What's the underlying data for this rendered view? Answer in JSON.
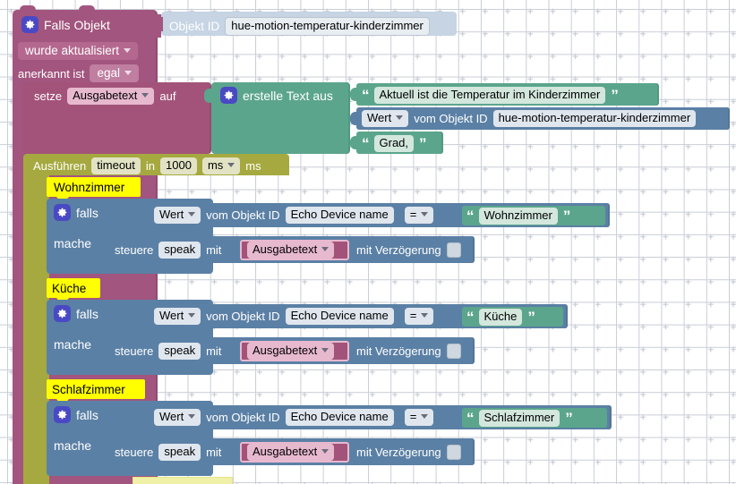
{
  "app": {
    "type": "blockly-workspace",
    "language": "de",
    "background": "#ffffff",
    "grid_color": "#c9cdd6"
  },
  "colors": {
    "trigger_purple": "#a2557e",
    "variable_pink": "#a35379",
    "timeout_olive": "#a5a93f",
    "text_green": "#5ba58c",
    "logic_blue": "#5b80a5",
    "objectid_lightblue": "#c6d4e4",
    "comment_yellow": "#ffff00",
    "gear_icon": "#4a49c4"
  },
  "trigger": {
    "gear_icon": "gear-icon",
    "title": "Falls Objekt",
    "objectid_label": "Objekt ID",
    "objectid_value": "hue-motion-temperatur-kinderzimmer",
    "condition_dropdown": "wurde aktualisiert",
    "ack_label": "anerkannt ist",
    "ack_dropdown": "egal"
  },
  "set_variable": {
    "set_label": "setze",
    "variable_dropdown": "Ausgabetext",
    "to_label": "auf"
  },
  "create_text": {
    "gear_icon": "gear-icon",
    "title": "erstelle Text aus",
    "open_quote": "“",
    "close_quote": "”",
    "parts": [
      {
        "kind": "text",
        "value": "Aktuell ist die Temperatur im Kinderzimmer"
      },
      {
        "kind": "getvalue",
        "attr_dropdown": "Wert",
        "from_label": "vom Objekt ID",
        "objectid": "hue-motion-temperatur-kinderzimmer"
      },
      {
        "kind": "text",
        "value": "Grad,"
      }
    ]
  },
  "timeout": {
    "run_label": "Ausführen",
    "name_field": "timeout",
    "in_label": "in",
    "delay_value": "1000",
    "unit_dropdown": "ms",
    "unit_suffix": "ms"
  },
  "branches": [
    {
      "comment": "Wohnzimmer",
      "gear_icon": "gear-icon",
      "if_label": "falls",
      "attr_dropdown": "Wert",
      "from_label": "vom Objekt ID",
      "objectid": "Echo Device name",
      "operator": "=",
      "compare_open_quote": "“",
      "compare_value": "Wohnzimmer",
      "compare_close_quote": "”",
      "do_label": "mache",
      "control_label": "steuere",
      "control_field": "speak",
      "with_label": "mit",
      "value_dropdown": "Ausgabetext",
      "delay_label": "mit Verzögerung",
      "delay_checked": false
    },
    {
      "comment": "Küche",
      "gear_icon": "gear-icon",
      "if_label": "falls",
      "attr_dropdown": "Wert",
      "from_label": "vom Objekt ID",
      "objectid": "Echo Device name",
      "operator": "=",
      "compare_open_quote": "“",
      "compare_value": "Küche",
      "compare_close_quote": "”",
      "do_label": "mache",
      "control_label": "steuere",
      "control_field": "speak",
      "with_label": "mit",
      "value_dropdown": "Ausgabetext",
      "delay_label": "mit Verzögerung",
      "delay_checked": false
    },
    {
      "comment": "Schlafzimmer",
      "gear_icon": "gear-icon",
      "if_label": "falls",
      "attr_dropdown": "Wert",
      "from_label": "vom Objekt ID",
      "objectid": "Echo Device name",
      "operator": "=",
      "compare_open_quote": "“",
      "compare_value": "Schlafzimmer",
      "compare_close_quote": "”",
      "do_label": "mache",
      "control_label": "steuere",
      "control_field": "speak",
      "with_label": "mit",
      "value_dropdown": "Ausgabetext",
      "delay_label": "mit Verzögerung",
      "delay_checked": false
    }
  ]
}
